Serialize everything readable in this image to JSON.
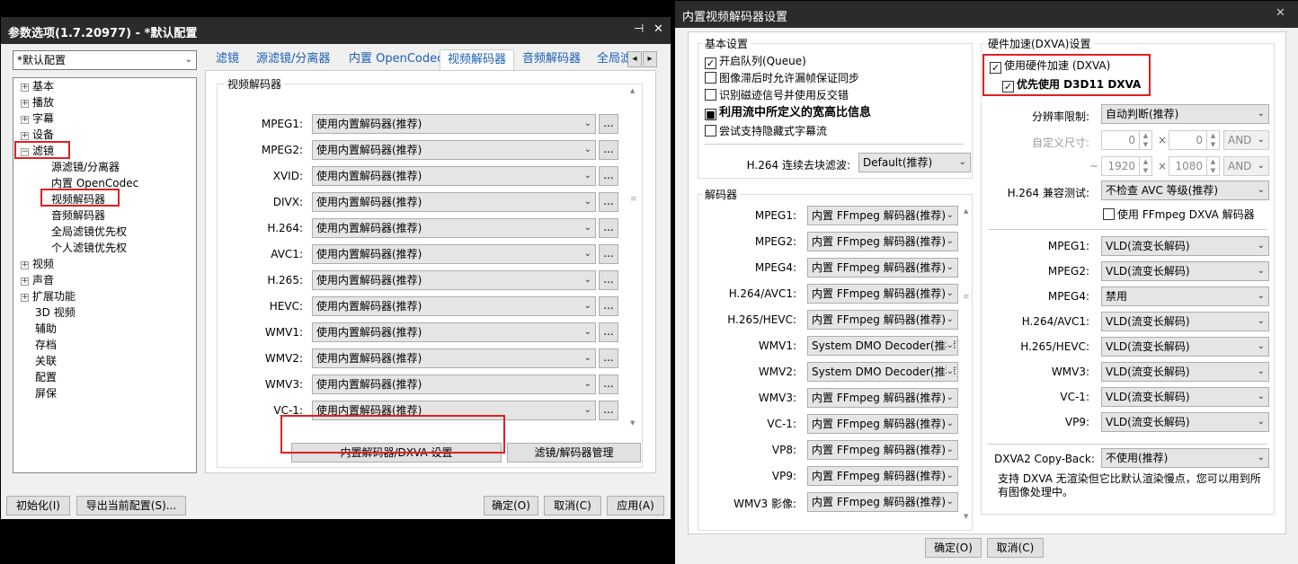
{
  "left": {
    "title": "参数选项(1.7.20977) - *默认配置",
    "pin": "⊣",
    "close": "✕",
    "profile": "*默认配置",
    "tree": [
      {
        "label": "基本",
        "exp": "+"
      },
      {
        "label": "播放",
        "exp": "+"
      },
      {
        "label": "字幕",
        "exp": "+"
      },
      {
        "label": "设备",
        "exp": "+"
      },
      {
        "label": "滤镜",
        "exp": "−"
      },
      {
        "label": "源滤镜/分离器",
        "exp": ""
      },
      {
        "label": "内置 OpenCodec",
        "exp": ""
      },
      {
        "label": "视频解码器",
        "exp": ""
      },
      {
        "label": "音频解码器",
        "exp": ""
      },
      {
        "label": "全局滤镜优先权",
        "exp": ""
      },
      {
        "label": "个人滤镜优先权",
        "exp": ""
      },
      {
        "label": "视频",
        "exp": "+"
      },
      {
        "label": "声音",
        "exp": "+"
      },
      {
        "label": "扩展功能",
        "exp": "+"
      },
      {
        "label": "3D 视频",
        "exp": ""
      },
      {
        "label": "辅助",
        "exp": ""
      },
      {
        "label": "存档",
        "exp": ""
      },
      {
        "label": "关联",
        "exp": ""
      },
      {
        "label": "配置",
        "exp": ""
      },
      {
        "label": "屏保",
        "exp": ""
      }
    ],
    "tabs": [
      "滤镜",
      "源滤镜/分离器",
      "内置 OpenCodec",
      "视频解码器",
      "音频解码器",
      "全局滤"
    ],
    "tab_prev": "◂",
    "tab_next": "▸",
    "group_title": "视频解码器",
    "codecs": [
      {
        "label": "MPEG1:",
        "value": "使用内置解码器(推荐)"
      },
      {
        "label": "MPEG2:",
        "value": "使用内置解码器(推荐)"
      },
      {
        "label": "XVID:",
        "value": "使用内置解码器(推荐)"
      },
      {
        "label": "DIVX:",
        "value": "使用内置解码器(推荐)"
      },
      {
        "label": "H.264:",
        "value": "使用内置解码器(推荐)"
      },
      {
        "label": "AVC1:",
        "value": "使用内置解码器(推荐)"
      },
      {
        "label": "H.265:",
        "value": "使用内置解码器(推荐)"
      },
      {
        "label": "HEVC:",
        "value": "使用内置解码器(推荐)"
      },
      {
        "label": "WMV1:",
        "value": "使用内置解码器(推荐)"
      },
      {
        "label": "WMV2:",
        "value": "使用内置解码器(推荐)"
      },
      {
        "label": "WMV3:",
        "value": "使用内置解码器(推荐)"
      },
      {
        "label": "VC-1:",
        "value": "使用内置解码器(推荐)"
      }
    ],
    "dots": "...",
    "btn_dxva": "内置解码器/DXVA 设置",
    "btn_manage": "滤镜/解码器管理",
    "btn_init": "初始化(I)",
    "btn_export": "导出当前配置(S)...",
    "btn_ok": "确定(O)",
    "btn_cancel": "取消(C)",
    "btn_apply": "应用(A)"
  },
  "right": {
    "title": "内置视频解码器设置",
    "close": "✕",
    "basic_title": "基本设置",
    "basic": [
      {
        "label": "开启队列(Queue)",
        "checked": true
      },
      {
        "label": "图像滞后时允许漏帧保证同步",
        "checked": false
      },
      {
        "label": "识别磁迹信号并使用反交错",
        "checked": false
      },
      {
        "label": "利用流中所定义的宽高比信息",
        "checked": true,
        "bold": true
      },
      {
        "label": "尝试支持隐藏式字幕流",
        "checked": false
      }
    ],
    "deblock_label": "H.264 连续去块滤波:",
    "deblock_value": "Default(推荐)",
    "dec_title": "解码器",
    "decoders": [
      {
        "label": "MPEG1:",
        "value": "内置 FFmpeg 解码器(推荐)"
      },
      {
        "label": "MPEG2:",
        "value": "内置 FFmpeg 解码器(推荐)"
      },
      {
        "label": "MPEG4:",
        "value": "内置 FFmpeg 解码器(推荐)"
      },
      {
        "label": "H.264/AVC1:",
        "value": "内置 FFmpeg 解码器(推荐)"
      },
      {
        "label": "H.265/HEVC:",
        "value": "内置 FFmpeg 解码器(推荐)"
      },
      {
        "label": "WMV1:",
        "value": "System DMO Decoder(推荐)"
      },
      {
        "label": "WMV2:",
        "value": "System DMO Decoder(推荐)"
      },
      {
        "label": "WMV3:",
        "value": "内置 FFmpeg 解码器(推荐)"
      },
      {
        "label": "VC-1:",
        "value": "内置 FFmpeg 解码器(推荐)"
      },
      {
        "label": "VP8:",
        "value": "内置 FFmpeg 解码器(推荐)"
      },
      {
        "label": "VP9:",
        "value": "内置 FFmpeg 解码器(推荐)"
      },
      {
        "label": "WMV3 影像:",
        "value": "内置 FFmpeg 解码器(推荐)"
      }
    ],
    "hw_title": "硬件加速(DXVA)设置",
    "hw_enable": "使用硬件加速 (DXVA)",
    "hw_d3d11": "优先使用 D3D11 DXVA",
    "res_label": "分辨率限制:",
    "res_value": "自动判断(推荐)",
    "custom_label": "自定义尺寸:",
    "tilde": "~",
    "times": "×",
    "min_w": "0",
    "min_h": "0",
    "max_w": "1920",
    "max_h": "1080",
    "and1": "AND",
    "and2": "AND",
    "avc_label": "H.264 兼容测试:",
    "avc_value": "不检查 AVC 等级(推荐)",
    "ffdxva": "使用 FFmpeg DXVA 解码器",
    "hw_codecs": [
      {
        "label": "MPEG1:",
        "value": "VLD(流变长解码)"
      },
      {
        "label": "MPEG2:",
        "value": "VLD(流变长解码)"
      },
      {
        "label": "MPEG4:",
        "value": "禁用"
      },
      {
        "label": "H.264/AVC1:",
        "value": "VLD(流变长解码)"
      },
      {
        "label": "H.265/HEVC:",
        "value": "VLD(流变长解码)"
      },
      {
        "label": "WMV3:",
        "value": "VLD(流变长解码)"
      },
      {
        "label": "VC-1:",
        "value": "VLD(流变长解码)"
      },
      {
        "label": "VP9:",
        "value": "VLD(流变长解码)"
      }
    ],
    "copyback_label": "DXVA2 Copy-Back:",
    "copyback_value": "不使用(推荐)",
    "note": "支持 DXVA 无渲染但它比默认渲染慢点，您可以用到所有图像处理中。",
    "btn_ok": "确定(O)",
    "btn_cancel": "取消(C)"
  }
}
